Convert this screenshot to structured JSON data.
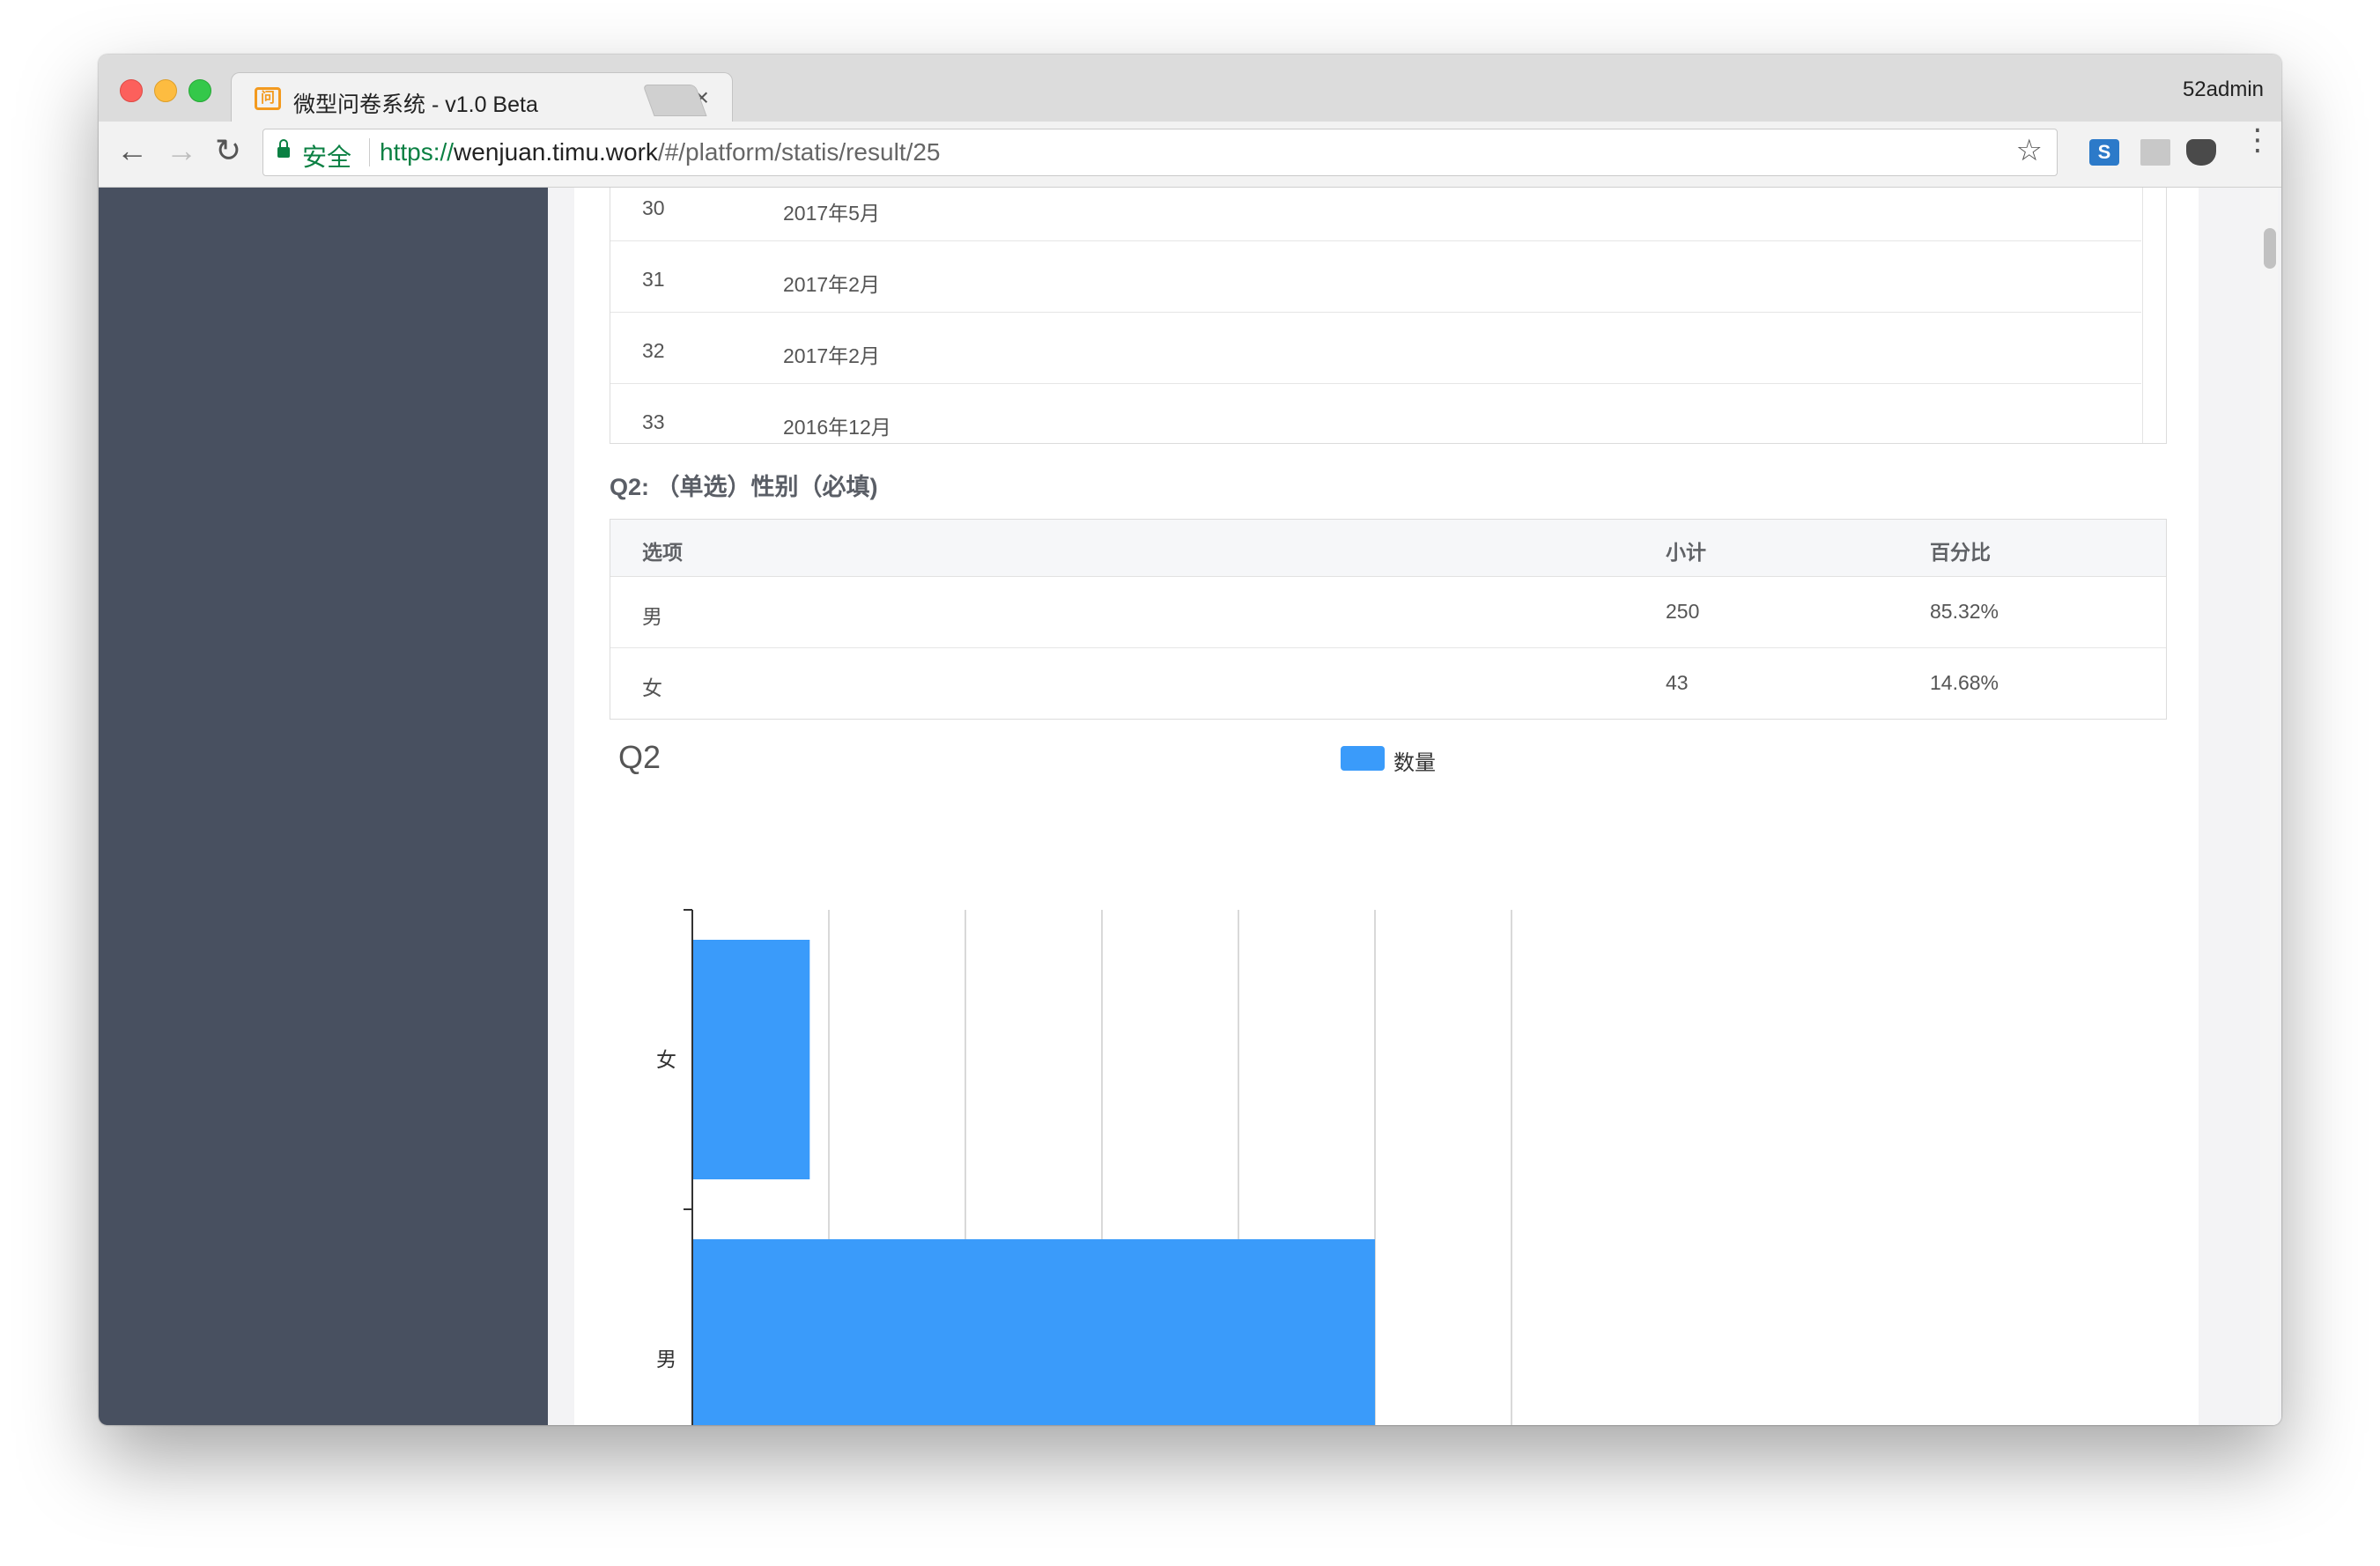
{
  "browser": {
    "tab_title": "微型问卷系统 - v1.0 Beta",
    "tab_favicon": "survey-logo",
    "profile": "52admin",
    "secure_label": "安全",
    "url_scheme": "https://",
    "url_host": "wenjuan.timu.work",
    "url_path": "/#/platform/statis/result/25",
    "back_icon": "←",
    "forward_icon": "→",
    "reload_icon": "↻",
    "star_icon": "☆",
    "close_icon": "×",
    "menu_icon": "⋮",
    "ext1_label": "S"
  },
  "prev_table": {
    "rows": [
      {
        "num": "30",
        "value": "2017年5月"
      },
      {
        "num": "31",
        "value": "2017年2月"
      },
      {
        "num": "32",
        "value": "2017年2月"
      },
      {
        "num": "33",
        "value": "2016年12月"
      }
    ]
  },
  "question": {
    "title": "Q2: （单选）性别（必填)",
    "headers": {
      "option": "选项",
      "count": "小计",
      "percent": "百分比"
    },
    "rows": [
      {
        "option": "男",
        "count": "250",
        "percent": "85.32%"
      },
      {
        "option": "女",
        "count": "43",
        "percent": "14.68%"
      }
    ]
  },
  "chart_data": {
    "type": "bar",
    "orientation": "horizontal",
    "title": "Q2",
    "categories": [
      "男",
      "女"
    ],
    "series": [
      {
        "name": "数量",
        "values": [
          250,
          43
        ],
        "color": "#3a9bfa"
      }
    ],
    "xlim": [
      0,
      300
    ],
    "xticks": [
      0,
      50,
      100,
      150,
      200,
      250,
      300
    ],
    "grid": "vertical",
    "legend": "top-center"
  }
}
